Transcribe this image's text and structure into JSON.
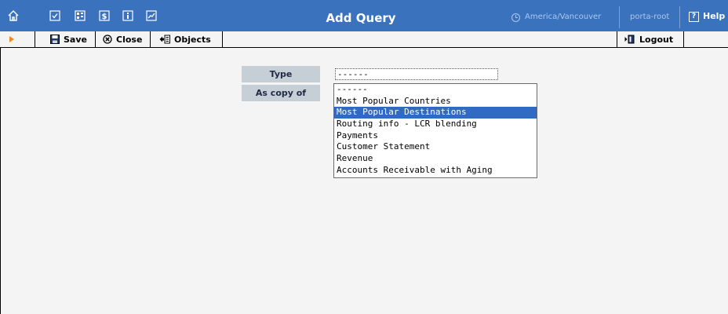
{
  "header": {
    "title": "Add Query",
    "timezone": "America/Vancouver",
    "user": "porta-root",
    "help_label": "Help",
    "nav_icons": [
      "home-icon",
      "checklist-icon",
      "tree-icon",
      "dollar-icon",
      "info-icon",
      "chart-icon"
    ]
  },
  "toolbar": {
    "save_label": "Save",
    "close_label": "Close",
    "objects_label": "Objects",
    "logout_label": "Logout"
  },
  "form": {
    "type_label": "Type",
    "as_copy_label": "As copy of",
    "type_value": "------",
    "options": [
      "------",
      "Most Popular Countries",
      "Most Popular Destinations",
      "Routing info - LCR blending",
      "Payments",
      "Customer Statement",
      "Revenue",
      "Accounts Receivable with Aging"
    ],
    "selected_option": "Most Popular Destinations"
  },
  "colors": {
    "header_bg": "#3a72bd",
    "label_bg": "#c6ced6",
    "selection": "#316ac5",
    "accent": "#f08a16"
  }
}
